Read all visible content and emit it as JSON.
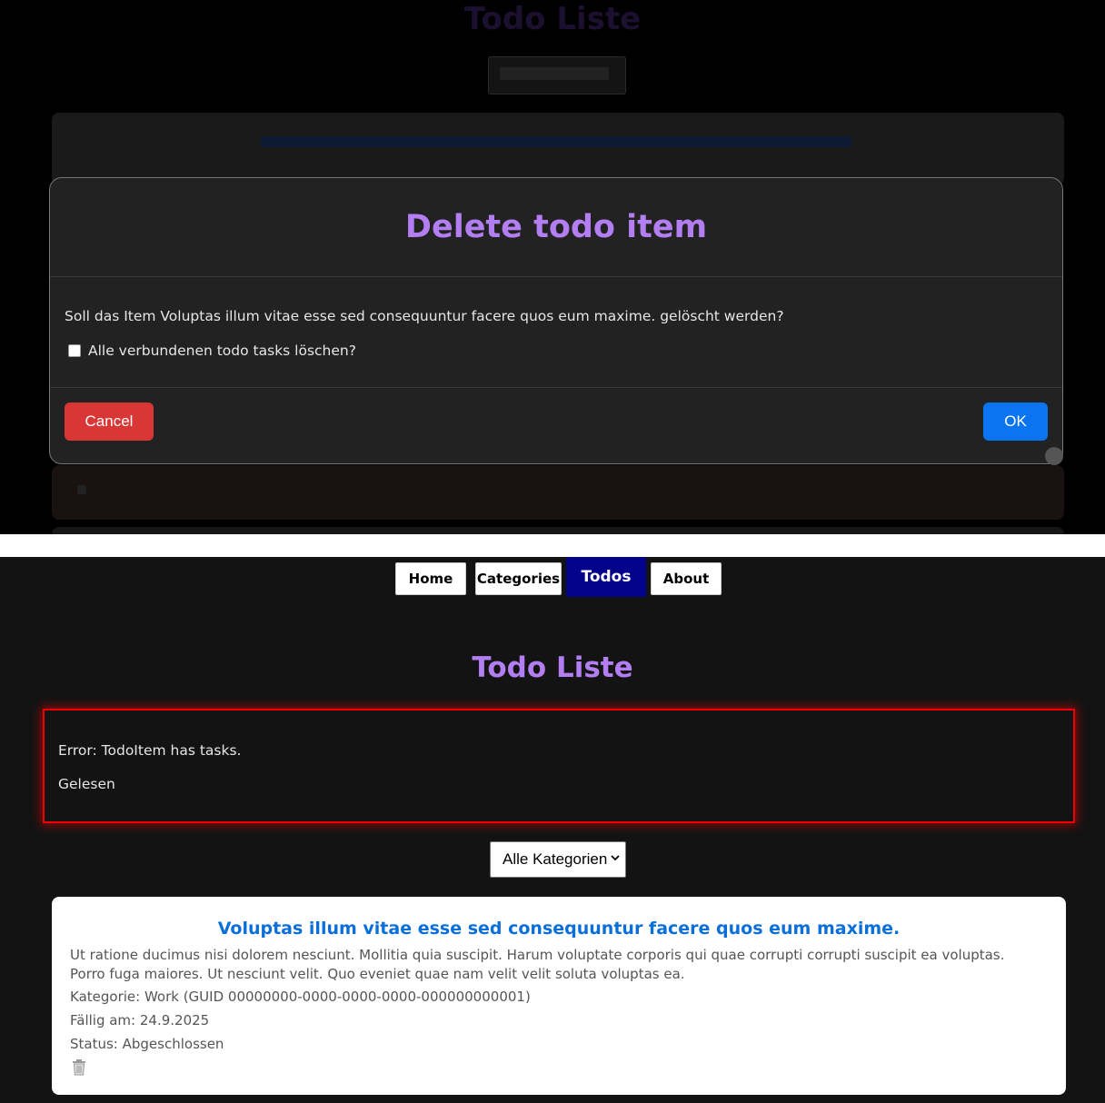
{
  "background_page": {
    "title": "Todo Liste",
    "select_value": "Alle Kategorien",
    "todo_title": "Voluptas illum vitae esse sed consequuntur facere quos eum maxime."
  },
  "modal": {
    "title": "Delete todo item",
    "question": "Soll das Item Voluptas illum vitae esse sed consequuntur facere quos eum maxime. gelöscht werden?",
    "checkbox_label": "Alle verbundenen todo tasks löschen?",
    "checkbox_checked": false,
    "cancel_label": "Cancel",
    "ok_label": "OK",
    "colors": {
      "cancel": "#d93636",
      "ok": "#0b74f0",
      "title": "#b27ef2"
    }
  },
  "nav": {
    "items": [
      {
        "label": "Home",
        "active": false
      },
      {
        "label": "Categories",
        "active": false
      },
      {
        "label": "Todos",
        "active": true
      },
      {
        "label": "About",
        "active": false
      }
    ],
    "active_color": "#02028c"
  },
  "page": {
    "title": "Todo Liste",
    "error": {
      "message": "Error: TodoItem has tasks.",
      "read_label": "Gelesen",
      "border_color": "#e00"
    },
    "category_filter": {
      "selected": "Alle Kategorien"
    },
    "todo": {
      "title": "Voluptas illum vitae esse sed consequuntur facere quos eum maxime.",
      "description": "Ut ratione ducimus nisi dolorem nesciunt. Mollitia quia suscipit. Harum voluptate corporis qui quae corrupti corrupti suscipit ea voluptas. Porro fuga maiores. Ut nesciunt velit. Quo eveniet quae nam velit velit soluta voluptas ea.",
      "category": "Kategorie: Work (GUID 00000000-0000-0000-0000-000000000001)",
      "due": "Fällig am: 24.9.2025",
      "status": "Status: Abgeschlossen",
      "delete_icon": "trash-icon"
    }
  }
}
